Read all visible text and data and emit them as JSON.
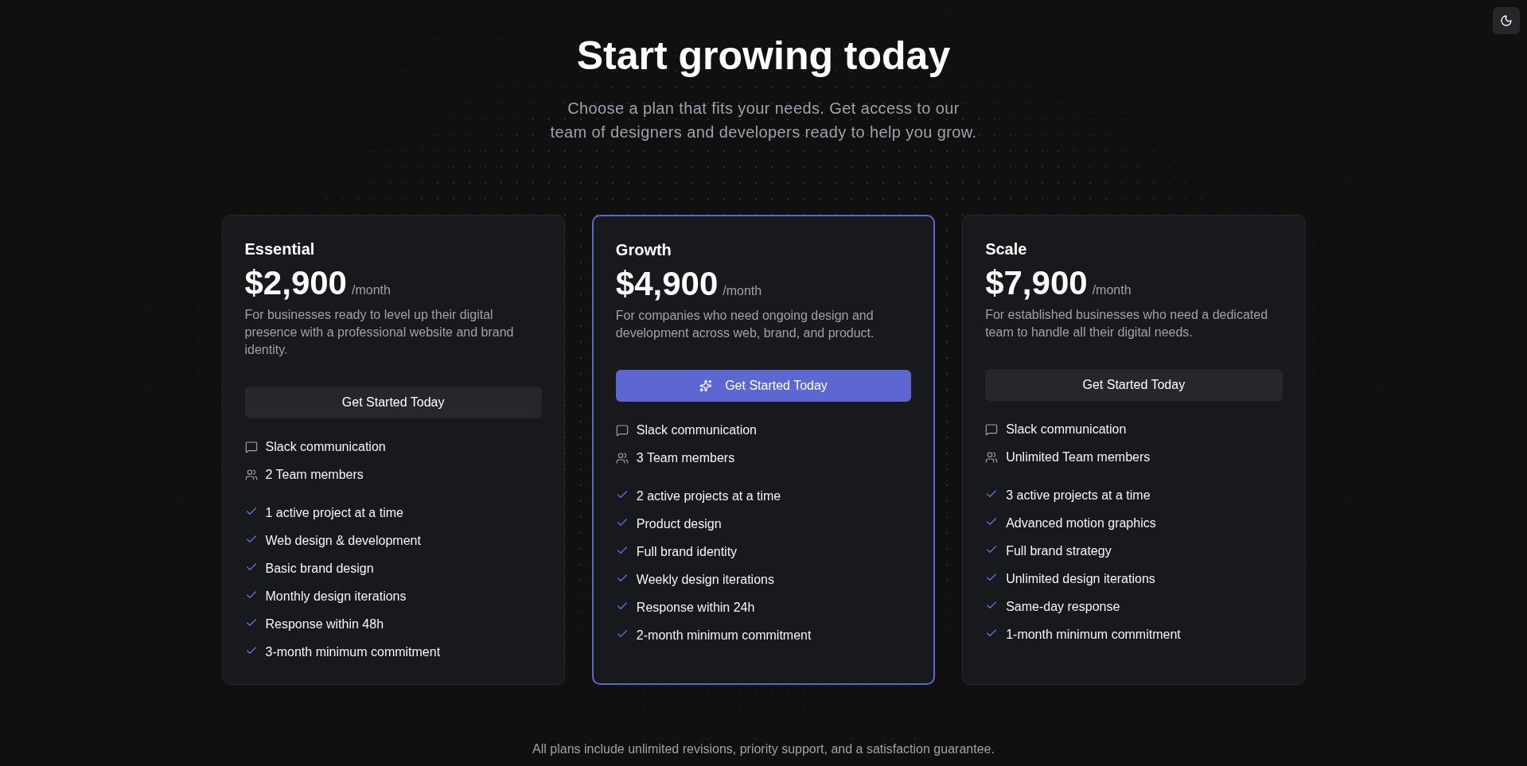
{
  "header": {
    "title": "Start growing today",
    "subtitle": "Choose a plan that fits your needs. Get access to our team of designers and developers ready to help you grow."
  },
  "plans": [
    {
      "name": "Essential",
      "price": "$2,900",
      "period": "/month",
      "description": "For businesses ready to level up their digital presence with a professional website and brand identity.",
      "featured": false,
      "button": "Get Started Today",
      "includes": [
        {
          "kind": "message",
          "text": "Slack communication"
        },
        {
          "kind": "team",
          "text": "2 Team members"
        }
      ],
      "features": [
        "1 active project at a time",
        "Web design & development",
        "Basic brand design",
        "Monthly design iterations",
        "Response within 48h",
        "3-month minimum commitment"
      ]
    },
    {
      "name": "Growth",
      "price": "$4,900",
      "period": "/month",
      "description": "For companies who need ongoing design and development across web, brand, and product.",
      "featured": true,
      "button": "Get Started Today",
      "includes": [
        {
          "kind": "message",
          "text": "Slack communication"
        },
        {
          "kind": "team",
          "text": "3 Team members"
        }
      ],
      "features": [
        "2 active projects at a time",
        "Product design",
        "Full brand identity",
        "Weekly design iterations",
        "Response within 24h",
        "2-month minimum commitment"
      ]
    },
    {
      "name": "Scale",
      "price": "$7,900",
      "period": "/month",
      "description": "For established businesses who need a dedicated team to handle all their digital needs.",
      "featured": false,
      "button": "Get Started Today",
      "includes": [
        {
          "kind": "message",
          "text": "Slack communication"
        },
        {
          "kind": "team",
          "text": "Unlimited Team members"
        }
      ],
      "features": [
        "3 active projects at a time",
        "Advanced motion graphics",
        "Full brand strategy",
        "Unlimited design iterations",
        "Same-day response",
        "1-month minimum commitment"
      ]
    }
  ],
  "footer_note": "All plans include unlimited revisions, priority support, and a satisfaction guarantee."
}
